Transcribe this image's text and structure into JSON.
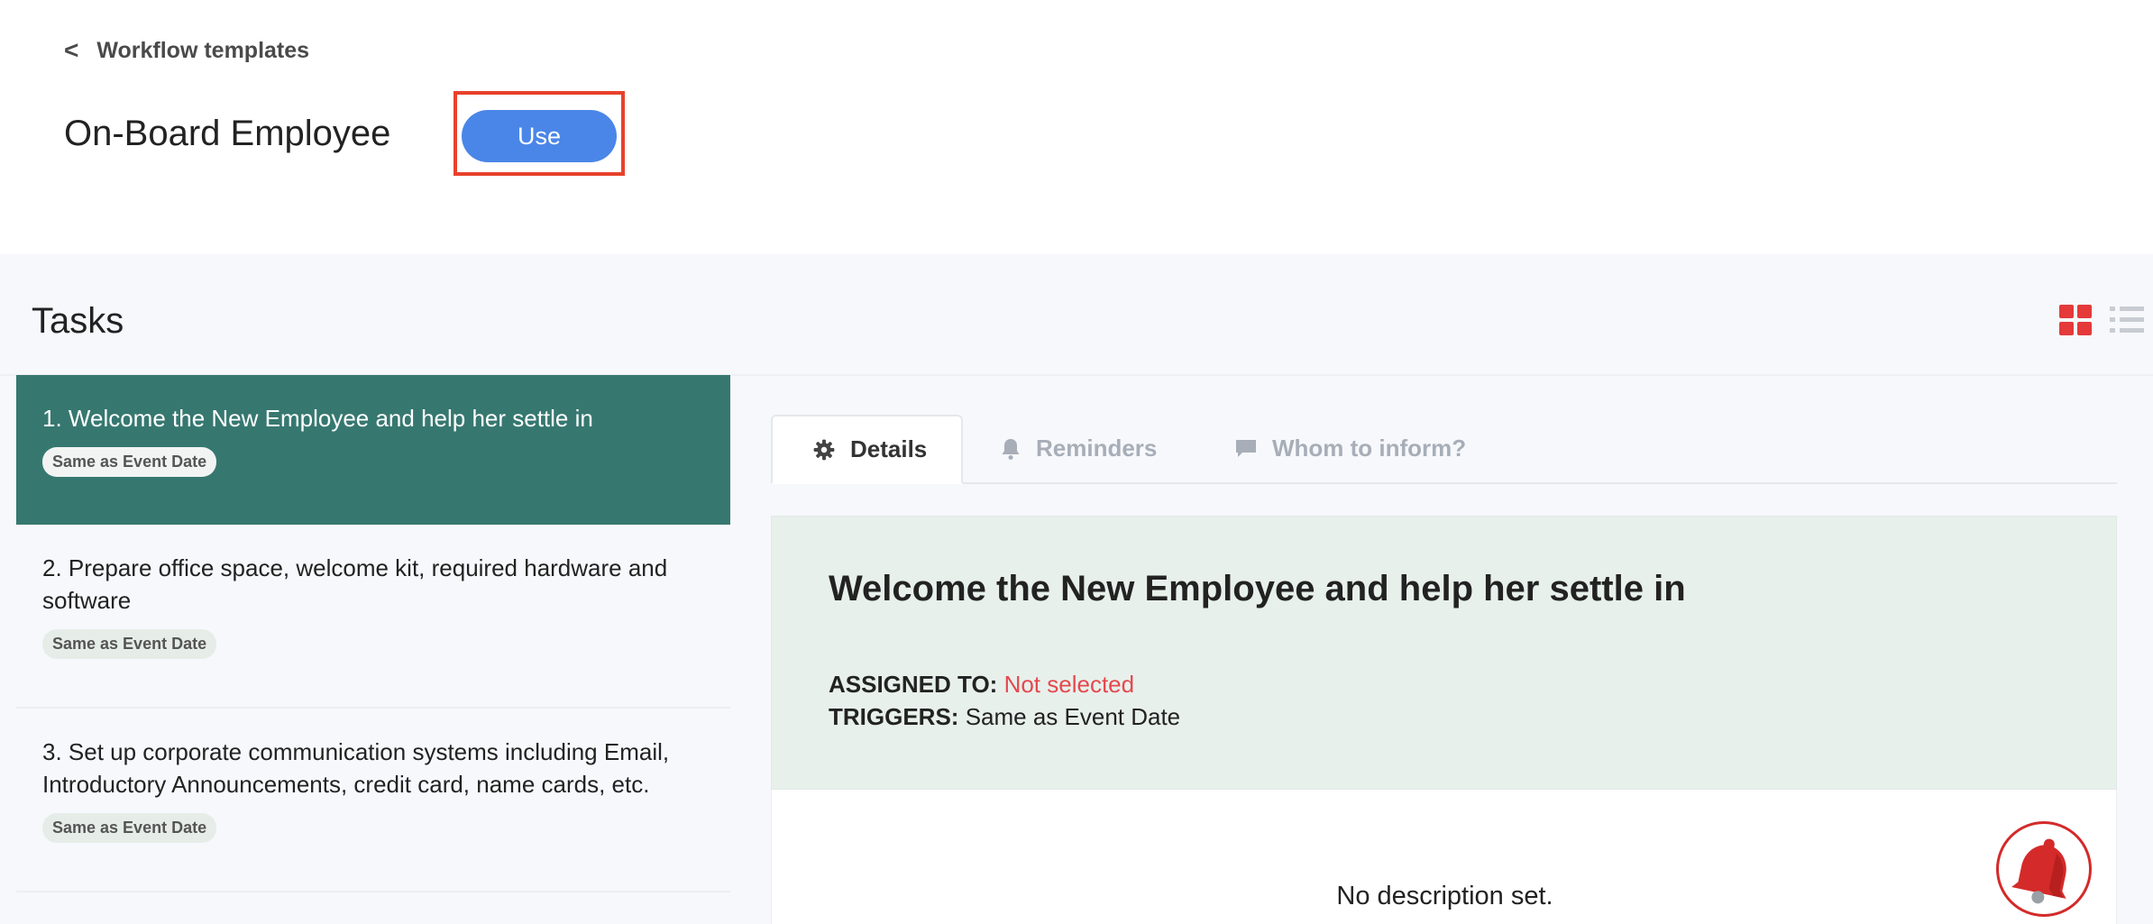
{
  "header": {
    "back_label": "Workflow templates",
    "back_icon": "chevron-left-icon",
    "title": "On-Board Employee",
    "use_label": "Use"
  },
  "tasks": {
    "title": "Tasks",
    "view_icons": [
      "grid-view-icon",
      "list-view-icon"
    ],
    "items": [
      {
        "text": "1. Welcome the New Employee and help her settle in",
        "badge": "Same as Event Date",
        "active": true
      },
      {
        "text": "2. Prepare office space, welcome kit, required hardware and software",
        "badge": "Same as Event Date",
        "active": false
      },
      {
        "text": "3. Set up corporate communication systems including Email, Introductory Announcements, credit card, name cards, etc.",
        "badge": "Same as Event Date",
        "active": false
      }
    ]
  },
  "detail": {
    "tabs": [
      {
        "label": "Details",
        "icon": "gear-icon",
        "active": true
      },
      {
        "label": "Reminders",
        "icon": "bell-icon",
        "active": false
      },
      {
        "label": "Whom to inform?",
        "icon": "chat-icon",
        "active": false
      }
    ],
    "title": "Welcome the New Employee and help her settle in",
    "assigned_label": "ASSIGNED TO:",
    "assigned_value": "Not selected",
    "triggers_label": "TRIGGERS:",
    "triggers_value": "Same as Event Date",
    "description": "No description set."
  },
  "colors": {
    "accent": "#4a86e8",
    "active_task": "#367870",
    "highlight": "#e8412c",
    "not_selected": "#e5484d",
    "grid_icon": "#e43a3a"
  }
}
